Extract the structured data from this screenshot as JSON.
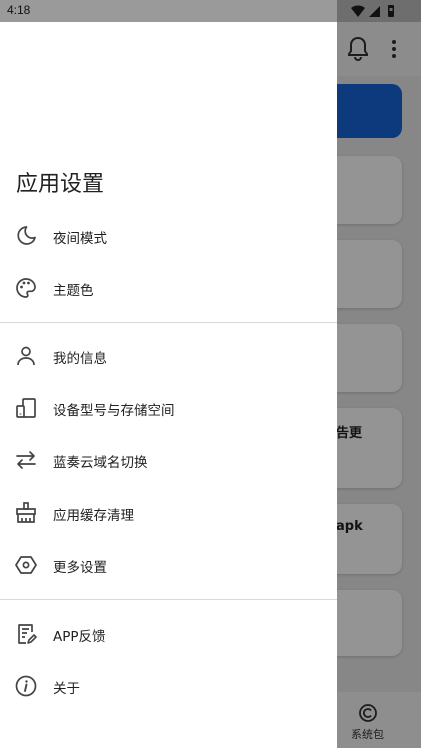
{
  "status_bar": {
    "time": "4:18"
  },
  "drawer": {
    "title": "应用设置",
    "sections": [
      {
        "items": [
          {
            "id": "night-mode",
            "label": "夜间模式",
            "icon": "moon-icon"
          },
          {
            "id": "theme-color",
            "label": "主题色",
            "icon": "palette-icon"
          }
        ]
      },
      {
        "items": [
          {
            "id": "my-info",
            "label": "我的信息",
            "icon": "person-icon"
          },
          {
            "id": "device-storage",
            "label": "设备型号与存储空间",
            "icon": "device-storage-icon"
          },
          {
            "id": "domain-switch",
            "label": "蓝奏云域名切换",
            "icon": "swap-arrows-icon"
          },
          {
            "id": "cache-clean",
            "label": "应用缓存清理",
            "icon": "broom-icon"
          },
          {
            "id": "more-settings",
            "label": "更多设置",
            "icon": "hexagon-settings-icon"
          }
        ]
      },
      {
        "items": [
          {
            "id": "app-feedback",
            "label": "APP反馈",
            "icon": "feedback-icon"
          },
          {
            "id": "about",
            "label": "关于",
            "icon": "info-icon"
          }
        ]
      }
    ]
  },
  "background": {
    "card_texts": [
      "告更",
      "apk"
    ],
    "bottom_nav_label": "系统包"
  }
}
